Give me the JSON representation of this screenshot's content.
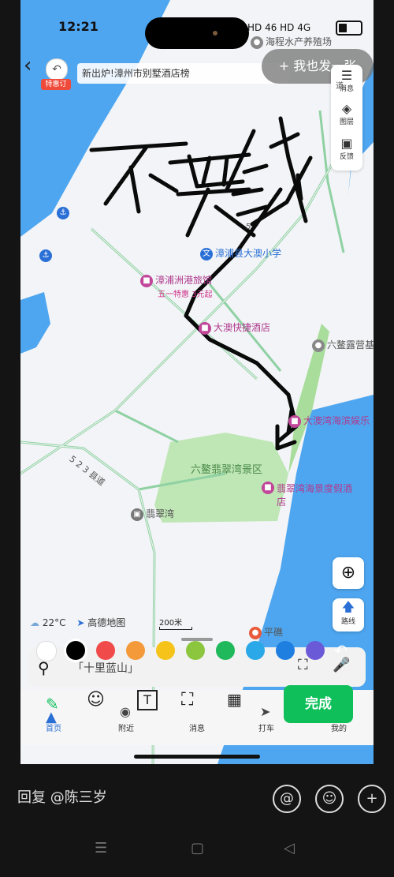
{
  "status_bar": {
    "time": "12:21",
    "icons": "HD  46  HD  4G"
  },
  "map": {
    "search_placeholder": "新出炉!漳州市别墅酒店榜",
    "special_badge": "特惠订",
    "share_button": "+ 我也发一张",
    "side_tools": [
      {
        "label": "消息",
        "icon": "message-icon"
      },
      {
        "label": "图层",
        "icon": "layers-icon"
      },
      {
        "label": "反馈",
        "icon": "feedback-icon"
      }
    ],
    "handwriting": "不要钱",
    "pois": [
      {
        "name": "海程水产养殖场",
        "type": "place"
      },
      {
        "name": "漳浦县大澳小学",
        "type": "school"
      },
      {
        "name": "漳浦洲港旅馆",
        "type": "hotel",
        "sub": "五一特惠 3元起"
      },
      {
        "name": "大澳快捷酒店",
        "type": "hotel"
      },
      {
        "name": "六鳌露营基",
        "type": "place"
      },
      {
        "name": "大澳湾海滨娱乐",
        "type": "hotel"
      },
      {
        "name": "六鳌翡翠湾景区",
        "type": "scenic"
      },
      {
        "name": "翡翠湾海景度假酒店",
        "type": "hotel"
      },
      {
        "name": "翡翠湾",
        "type": "bus"
      },
      {
        "name": "平礁",
        "type": "place"
      }
    ],
    "road_labels": [
      "5 2 3 县道",
      "5",
      "道"
    ],
    "weather": "22°C",
    "map_brand": "高德地图",
    "scale": "200米",
    "route_button": "路线"
  },
  "palette": {
    "colors": [
      "#ffffff",
      "#000000",
      "#f04a4a",
      "#f59a3a",
      "#f5c31a",
      "#8cc63f",
      "#1fb85a",
      "#2aa8e8",
      "#1f7fe0",
      "#6a5ad8"
    ]
  },
  "search_input": "「十里蓝山」",
  "tabs": [
    "首页",
    "附近",
    "消息",
    "打车",
    "我的"
  ],
  "done_button": "完成",
  "reply": {
    "placeholder": "回复 @陈三岁"
  }
}
